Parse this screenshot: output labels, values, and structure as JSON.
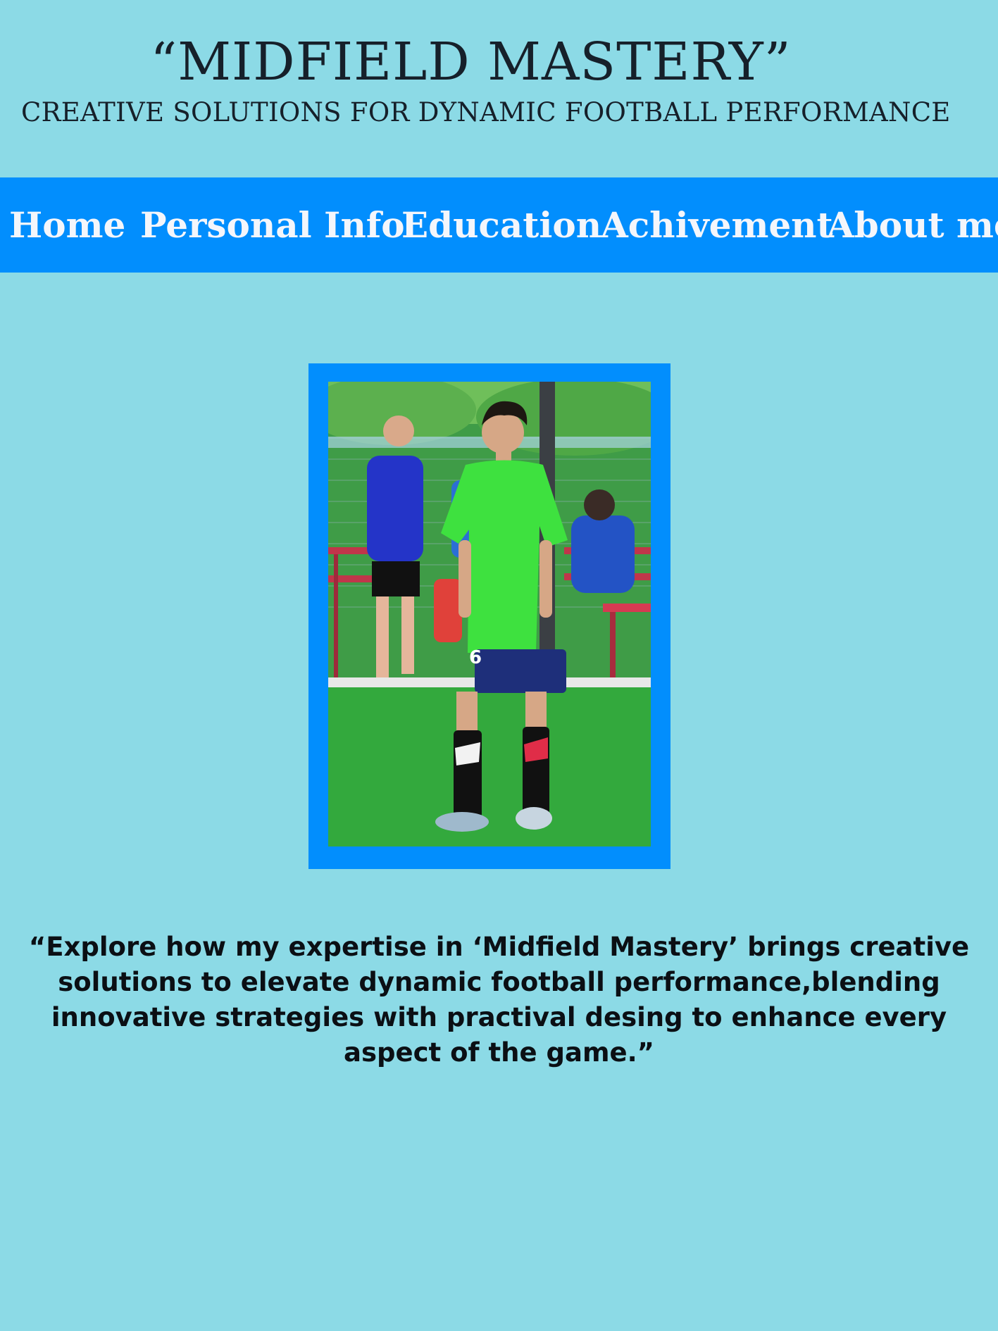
{
  "header": {
    "title": "“MIDFIELD MASTERY”",
    "subtitle": "CREATIVE SOLUTIONS FOR DYNAMIC FOOTBALL PERFORMANCE"
  },
  "nav": {
    "items": [
      {
        "label": "Home"
      },
      {
        "label": "Personal Info"
      },
      {
        "label": "Education"
      },
      {
        "label": "Achivement"
      },
      {
        "label": "About me"
      }
    ]
  },
  "hero": {
    "photo_subject": "football-player-photo",
    "jersey_number": "6"
  },
  "quote": {
    "text": "“Explore how my expertise in ‘Midfield Mastery’ brings creative solutions to elevate dynamic football performance,blending innovative strategies with practival desing to enhance every aspect of the game.”"
  },
  "colors": {
    "page_background": "#8cdae6",
    "nav_background": "#028efd",
    "nav_text": "#f4f6fb",
    "heading_text": "#16202a",
    "frame": "#028efd"
  }
}
